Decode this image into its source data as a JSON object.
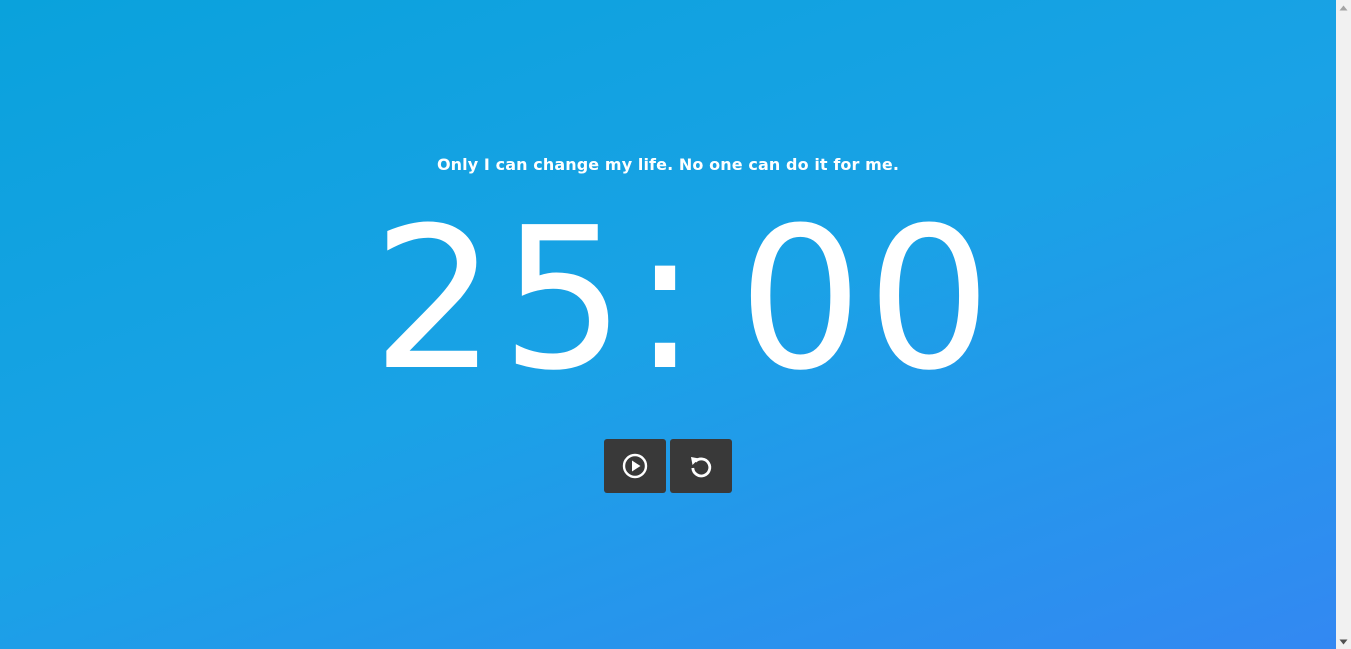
{
  "quote": "Only I can change my life. No one can do it for me.",
  "timer": {
    "minutes": "25",
    "separator": ":",
    "seconds": "00"
  },
  "controls": {
    "play_icon": "play-circle-icon",
    "reset_icon": "reset-icon"
  },
  "colors": {
    "gradient_start": "#0aa2dc",
    "gradient_end": "#3388f2",
    "text": "#ffffff",
    "button_bg": "#393939"
  }
}
